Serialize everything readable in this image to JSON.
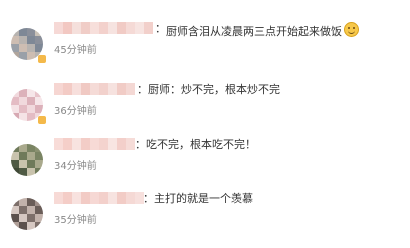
{
  "comments": [
    {
      "text": "厨师含泪从凌晨两三点开始起来做饭",
      "time": "45分钟前",
      "emoji_icon": "grinning-face-icon",
      "avatar_colors": [
        "#b7b3b0",
        "#c9c2b8",
        "#9aa0a8",
        "#7e8896",
        "#a59c98",
        "#cdbdb2",
        "#8a8f9a",
        "#b0a59c"
      ],
      "name_colors": [
        "#f6d9d6",
        "#f2c8c2",
        "#f5e0dc",
        "#f0cdc7",
        "#f7dfdb",
        "#f3d1cc",
        "#f6e3e0",
        "#f1cbc5",
        "#f5dad6",
        "#f7e4e1",
        "#f2d0cb"
      ]
    },
    {
      "text": "厨师：炒不完，根本炒不完",
      "time": "36分钟前",
      "avatar_colors": [
        "#f1d9dd",
        "#e8c4cb",
        "#f5e3e6",
        "#dcb1ba",
        "#efd2d8",
        "#e4bcc4",
        "#f6e6e9",
        "#d7a9b3"
      ],
      "name_colors": [
        "#f6d6d2",
        "#f3cbc5",
        "#f7dfdc",
        "#f0c9c3",
        "#f5dbd7",
        "#f2d1cc",
        "#f6e2df",
        "#f1ccc6",
        "#f4d8d4"
      ]
    },
    {
      "text": "吃不完，根本吃不完！",
      "time": "34分钟前",
      "avatar_colors": [
        "#6f7a5a",
        "#8a9170",
        "#4f5a44",
        "#a9a98c",
        "#5e6a4d",
        "#c9c3ad",
        "#7a8463",
        "#3f4936"
      ],
      "name_colors": [
        "#f8dcd8",
        "#f5cfc9",
        "#f8e3e0",
        "#f3cdc7",
        "#f7dad6",
        "#f4d3ce",
        "#f8e5e2",
        "#f3cfca",
        "#f6dcd8"
      ]
    },
    {
      "text": "主打的就是一个羡慕",
      "time": "35分钟前",
      "avatar_colors": [
        "#7d6f6a",
        "#a0908a",
        "#5c514d",
        "#c2b2ab",
        "#8e7f79",
        "#d6c8c2",
        "#6a5d58",
        "#b09f98"
      ],
      "name_colors": [
        "#f7dad6",
        "#f4cdc7",
        "#f8e2df",
        "#f2cbc5",
        "#f6d8d4",
        "#f3d0cb",
        "#f7e3e0",
        "#f2ccc6",
        "#f5d9d5",
        "#f7e0dd"
      ]
    }
  ]
}
